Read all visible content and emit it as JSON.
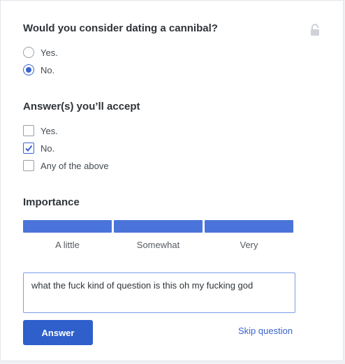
{
  "question": {
    "title": "Would you consider dating a cannibal?",
    "options": [
      {
        "label": "Yes.",
        "selected": false
      },
      {
        "label": "No.",
        "selected": true
      }
    ]
  },
  "accept": {
    "title": "Answer(s) you’ll accept",
    "options": [
      {
        "label": "Yes.",
        "checked": false
      },
      {
        "label": "No.",
        "checked": true
      },
      {
        "label": "Any of the above",
        "checked": false
      }
    ]
  },
  "importance": {
    "title": "Importance",
    "levels": [
      "A little",
      "Somewhat",
      "Very"
    ],
    "selected": "Very"
  },
  "explanation": {
    "value": "what the fuck kind of question is this oh my fucking god"
  },
  "actions": {
    "answer_label": "Answer",
    "skip_label": "Skip question"
  },
  "colors": {
    "accent": "#3a63cf",
    "bar": "#4a74d9",
    "button": "#2f5fcb"
  },
  "icons": {
    "privacy": "lock-icon"
  }
}
